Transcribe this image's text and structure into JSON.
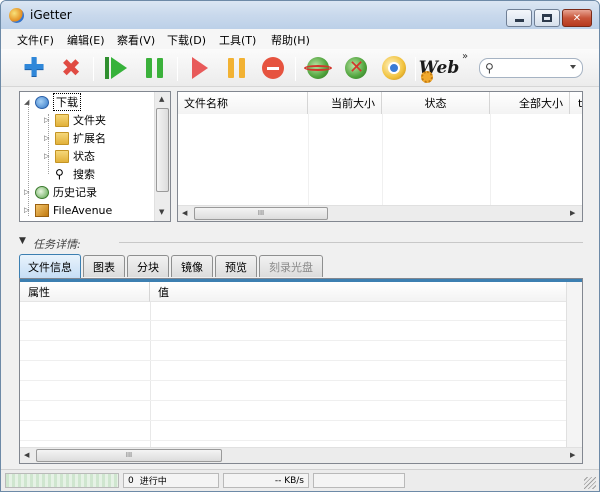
{
  "window": {
    "title": "iGetter",
    "colors": {
      "accent": "#3c7fb1",
      "close": "#c8553a"
    }
  },
  "menu": {
    "items": [
      "文件(F)",
      "编辑(E)",
      "察看(V)",
      "下载(D)",
      "工具(T)",
      "帮助(H)"
    ]
  },
  "toolbar": {
    "buttons": [
      {
        "icon": "add-icon"
      },
      {
        "icon": "delete-icon"
      },
      {
        "icon": "start-all-icon"
      },
      {
        "icon": "pause-all-icon"
      },
      {
        "icon": "start-icon"
      },
      {
        "icon": "pause-icon"
      },
      {
        "icon": "stop-icon"
      },
      {
        "icon": "connect-icon"
      },
      {
        "icon": "disconnect-icon"
      },
      {
        "icon": "scheduler-icon"
      },
      {
        "icon": "web-icon"
      }
    ],
    "web_label": "Web",
    "more": "»",
    "search": {
      "icon": "search-icon",
      "value": ""
    }
  },
  "tree": {
    "items": [
      {
        "label": "下载",
        "icon": "download-globe-icon",
        "selected": true
      },
      {
        "label": "文件夹",
        "icon": "folder-icon"
      },
      {
        "label": "扩展名",
        "icon": "folder-icon"
      },
      {
        "label": "状态",
        "icon": "folder-icon"
      },
      {
        "label": "搜索",
        "icon": "magnifier-icon"
      },
      {
        "label": "历史记录",
        "icon": "history-clock-icon"
      },
      {
        "label": "FileAvenue",
        "icon": "fileavenue-icon"
      }
    ]
  },
  "list": {
    "columns": [
      "文件名称",
      "当前大小",
      "状态",
      "全部大小",
      "t"
    ],
    "hscroll_grip": "III"
  },
  "details": {
    "label": "任务详情:",
    "tabs": [
      "文件信息",
      "图表",
      "分块",
      "镜像",
      "预览",
      "刻录光盘"
    ],
    "active_tab": "文件信息",
    "columns": [
      "属性",
      "值"
    ],
    "hscroll_grip": "III"
  },
  "status": {
    "queue_count": "0",
    "queue_label": "进行中",
    "speed": "-- KB/s"
  }
}
